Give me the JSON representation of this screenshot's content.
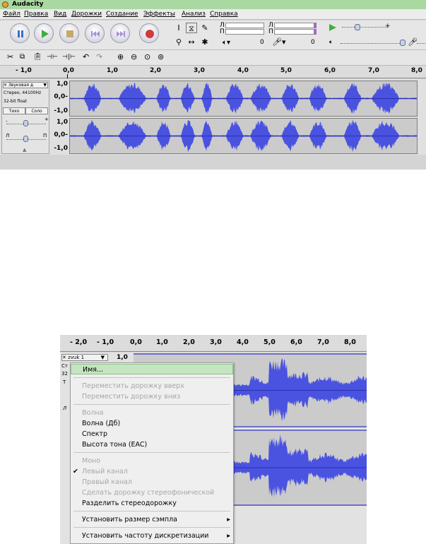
{
  "app": {
    "title": "Audacity"
  },
  "menubar": [
    "Файл",
    "Правка",
    "Вид",
    "Дорожки",
    "Создание",
    "Эффекты",
    "Анализ",
    "Справка"
  ],
  "meters": {
    "left_label": "Л",
    "right_label": "П",
    "zero": "0"
  },
  "ruler_top": [
    "- 1,0",
    "0,0",
    "1,0",
    "2,0",
    "3,0",
    "4,0",
    "5,0",
    "6,0",
    "7,0",
    "8,0"
  ],
  "track": {
    "name": "Звуковая д",
    "info1": "Стерео, 44100Hz",
    "info2": "32-bit float",
    "mute": "Тихо",
    "solo": "Соло",
    "gain_minus": "-",
    "gain_plus": "+",
    "pan_left": "Л",
    "pan_right": "П",
    "scale": [
      "1,0",
      "0,0-",
      "-1,0",
      "1,0",
      "0,0-",
      "-1,0"
    ]
  },
  "ruler_bottom": [
    "- 2,0",
    "- 1,0",
    "0,0",
    "1,0",
    "2,0",
    "3,0",
    "4,0",
    "5,0",
    "6,0",
    "7,0",
    "8,0"
  ],
  "track2": {
    "name": "zvuk 1",
    "scale_top": "1,0",
    "info_partial": "Ст",
    "bits_partial": "32",
    "t_partial": "Т",
    "l_partial": "Л"
  },
  "context_menu": {
    "items": [
      {
        "label": "Имя...",
        "disabled": false,
        "highlighted": true
      },
      {
        "label": "Переместить дорожку вверх",
        "disabled": true
      },
      {
        "label": "Переместить дорожку вниз",
        "disabled": true
      },
      {
        "label": "Волна",
        "disabled": true
      },
      {
        "label": "Волна (Дб)",
        "disabled": false
      },
      {
        "label": "Спектр",
        "disabled": false
      },
      {
        "label": "Высота тона (EAC)",
        "disabled": false
      },
      {
        "label": "Моно",
        "disabled": true
      },
      {
        "label": "Левый канал",
        "disabled": true,
        "checked": true
      },
      {
        "label": "Правый канал",
        "disabled": true
      },
      {
        "label": "Сделать дорожку стереофонической",
        "disabled": true
      },
      {
        "label": "Разделить стереодорожку",
        "disabled": false
      },
      {
        "label": "Установить размер сэмпла",
        "disabled": false,
        "submenu": true
      },
      {
        "label": "Установить частоту дискретизации",
        "disabled": false,
        "submenu": true
      }
    ],
    "check_mark": "✔",
    "submenu_arrow": "▸"
  },
  "colors": {
    "wave": "#4a52e0",
    "wave_dark": "#2a2fb0",
    "highlight": "#c3e6c0"
  }
}
